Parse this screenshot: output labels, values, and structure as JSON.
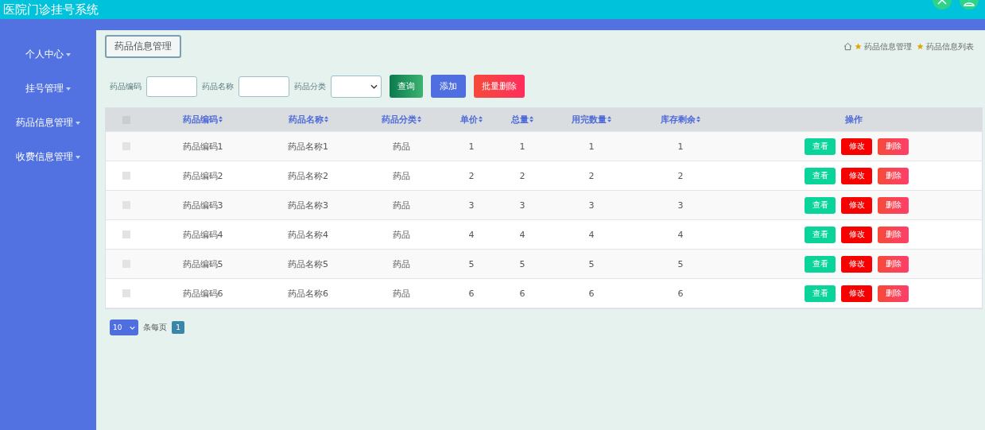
{
  "header": {
    "title": "医院门诊挂号系统"
  },
  "sidebar": {
    "items": [
      {
        "label": "个人中心"
      },
      {
        "label": "挂号管理"
      },
      {
        "label": "药品信息管理"
      },
      {
        "label": "收费信息管理"
      }
    ]
  },
  "page_title": "药品信息管理",
  "breadcrumb": [
    "药品信息管理",
    "药品信息列表"
  ],
  "search": {
    "fields": [
      {
        "label": "药品编码",
        "kind": "input"
      },
      {
        "label": "药品名称",
        "kind": "input"
      },
      {
        "label": "药品分类",
        "kind": "select"
      }
    ],
    "buttons": [
      {
        "label": "查询",
        "kind": "search"
      },
      {
        "label": "添加",
        "kind": "add"
      },
      {
        "label": "批量删除",
        "kind": "delete"
      }
    ]
  },
  "table": {
    "all_selected": false,
    "columns": [
      {
        "label": "药品编码",
        "sortable": true
      },
      {
        "label": "药品名称",
        "sortable": true
      },
      {
        "label": "药品分类",
        "sortable": true
      },
      {
        "label": "单价",
        "sortable": true
      },
      {
        "label": "总量",
        "sortable": true
      },
      {
        "label": "用完数量",
        "sortable": true
      },
      {
        "label": "库存剩余",
        "sortable": true
      },
      {
        "label": "操作",
        "sortable": false
      }
    ],
    "rows": [
      {
        "selected": false,
        "cells": [
          "药品编码1",
          "药品名称1",
          "药品",
          "1",
          "1",
          "1",
          "1"
        ],
        "actions": [
          {
            "label": "查看",
            "kind": "view"
          },
          {
            "label": "修改",
            "kind": "edit"
          },
          {
            "label": "删除",
            "kind": "delete"
          }
        ]
      },
      {
        "selected": false,
        "cells": [
          "药品编码2",
          "药品名称2",
          "药品",
          "2",
          "2",
          "2",
          "2"
        ],
        "actions": [
          {
            "label": "查看",
            "kind": "view"
          },
          {
            "label": "修改",
            "kind": "edit"
          },
          {
            "label": "删除",
            "kind": "delete"
          }
        ]
      },
      {
        "selected": false,
        "cells": [
          "药品编码3",
          "药品名称3",
          "药品",
          "3",
          "3",
          "3",
          "3"
        ],
        "actions": [
          {
            "label": "查看",
            "kind": "view"
          },
          {
            "label": "修改",
            "kind": "edit"
          },
          {
            "label": "删除",
            "kind": "delete"
          }
        ]
      },
      {
        "selected": false,
        "cells": [
          "药品编码4",
          "药品名称4",
          "药品",
          "4",
          "4",
          "4",
          "4"
        ],
        "actions": [
          {
            "label": "查看",
            "kind": "view"
          },
          {
            "label": "修改",
            "kind": "edit"
          },
          {
            "label": "删除",
            "kind": "delete"
          }
        ]
      },
      {
        "selected": false,
        "cells": [
          "药品编码5",
          "药品名称5",
          "药品",
          "5",
          "5",
          "5",
          "5"
        ],
        "actions": [
          {
            "label": "查看",
            "kind": "view"
          },
          {
            "label": "修改",
            "kind": "edit"
          },
          {
            "label": "删除",
            "kind": "delete"
          }
        ]
      },
      {
        "selected": false,
        "cells": [
          "药品编码6",
          "药品名称6",
          "药品",
          "6",
          "6",
          "6",
          "6"
        ],
        "actions": [
          {
            "label": "查看",
            "kind": "view"
          },
          {
            "label": "修改",
            "kind": "edit"
          },
          {
            "label": "删除",
            "kind": "delete"
          }
        ]
      }
    ]
  },
  "pagination": {
    "page_size": "10",
    "page_size_label": "条每页",
    "pages": [
      {
        "label": "1",
        "selected": true
      }
    ]
  }
}
